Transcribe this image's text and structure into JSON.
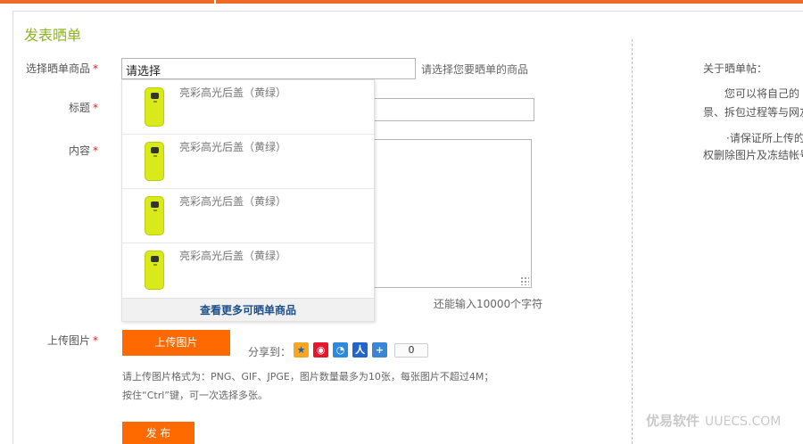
{
  "page": {
    "title": "发表晒单"
  },
  "form": {
    "product": {
      "label": "选择晒单商品",
      "value": "请选择",
      "hint": "请选择您要晒单的商品"
    },
    "title": {
      "label": "标题"
    },
    "content": {
      "label": "内容",
      "counter": "还能输入10000个字符"
    },
    "upload": {
      "label": "上传图片",
      "button": "上传图片",
      "note_line1": "请上传图片格式为：PNG、GIF、JPGE，图片数量最多为10张，每张图片不超过4M；",
      "note_line2": "按住“Ctrl”键，可一次选择多张。"
    },
    "share": {
      "label": "分享到：",
      "count": "0"
    },
    "publish": "发 布",
    "required_mark": "*"
  },
  "dropdown": {
    "items": [
      {
        "name": "亮彩高光后盖（黄绿）"
      },
      {
        "name": "亮彩高光后盖（黄绿）"
      },
      {
        "name": "亮彩高光后盖（黄绿）"
      },
      {
        "name": "亮彩高光后盖（黄绿）"
      }
    ],
    "more": "查看更多可晒单商品"
  },
  "sidebar": {
    "heading": "关于晒单帖：",
    "line1": "您可以将自己的",
    "line2": "景、拆包过程等与网友",
    "line3": "·请保证所上传的",
    "line4": "权删除图片及冻结帐号"
  },
  "watermark": {
    "cn": "优易软件",
    "en": "UUECS.COM"
  },
  "colors": {
    "accent": "#f06a25",
    "button": "#ff6a00",
    "title": "#8cb426",
    "link": "#1d4f8c",
    "product": "#d9ea1a"
  }
}
